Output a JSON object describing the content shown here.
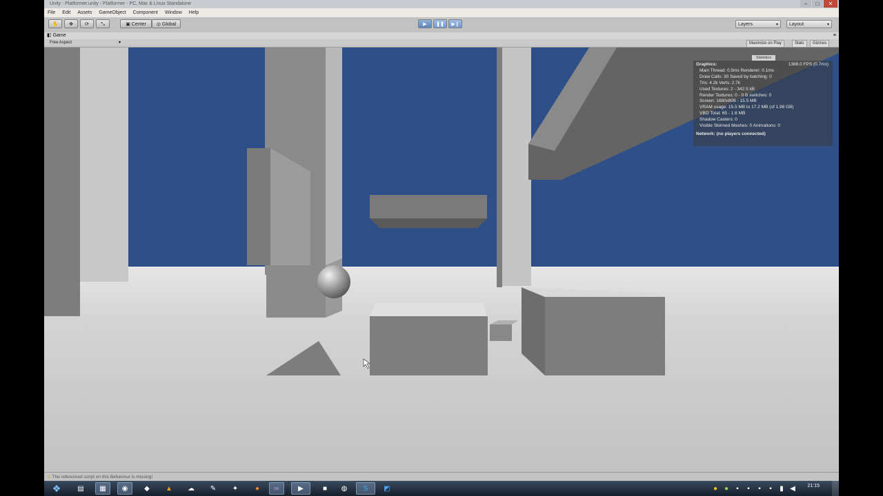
{
  "window": {
    "title": "Unity - Platformer.unity - Platformer - PC, Mac & Linux Standalone"
  },
  "menu": [
    "File",
    "Edit",
    "Assets",
    "GameObject",
    "Component",
    "Window",
    "Help"
  ],
  "toolbar": {
    "pivot_label": "Center",
    "space_label": "Global",
    "layers_label": "Layers",
    "layout_label": "Layout"
  },
  "game_panel": {
    "tab_label": "Game",
    "aspect": "Free Aspect",
    "maximize_on_play": "Maximize on Play",
    "stats": "Stats",
    "gizmos": "Gizmos"
  },
  "stats": {
    "tab_label": "Statistics",
    "header": "Graphics:",
    "fps": "1388.0 FPS (0.7ms)",
    "lines": [
      "Main Thread: 0.5ms  Renderer: 0.1ms",
      "Draw Calls: 30    Saved by batching: 0",
      "Tris: 4.2k    Verts: 2.7k",
      "Used Textures: 2 - 342.5 kB",
      "Render Textures: 0 - 0 B   switches: 0",
      "Screen: 1680x806 - 15.5 MB",
      "VRAM usage: 15.5 MB to 17.2 MB (of 1.98 GB)",
      "VBO Total: 65 - 1.6 MB",
      "Shadow Casters: 0",
      "Visible Skinned Meshes: 0    Animations: 0"
    ],
    "network": "Network: (no players connected)"
  },
  "status": {
    "message": "The referenced script on this Behaviour is missing!"
  },
  "taskbar": {
    "clock": "21:15"
  },
  "colors": {
    "sky": "#2e4f87",
    "floor": "#c4c4c4",
    "play_active": "#5d86bf"
  }
}
